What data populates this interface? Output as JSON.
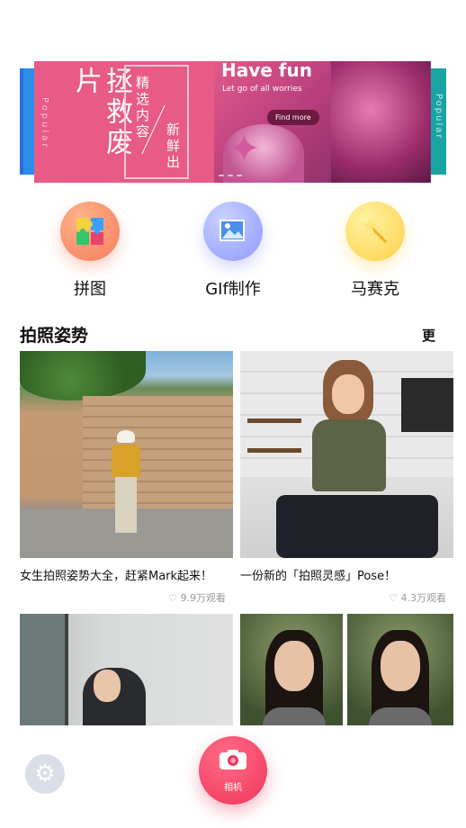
{
  "banner": {
    "side_text": "Popular",
    "vertical_small": "Popular",
    "big_title": "拯救废片",
    "frame_line1": "精选内容",
    "frame_line2": "新鲜出",
    "headline": "Have fun",
    "subline": "Let go of all worries",
    "cta": "Find more"
  },
  "features": [
    {
      "label": "拼图",
      "icon": "puzzle-icon",
      "color": "#f57b5d"
    },
    {
      "label": "GIf制作",
      "icon": "gif-image-icon",
      "color": "#8f98ff"
    },
    {
      "label": "马赛克",
      "icon": "sparkle-wand-icon",
      "color": "#ffd14a"
    }
  ],
  "section": {
    "title": "拍照姿势",
    "more": "更"
  },
  "cards": [
    {
      "caption": "女生拍照姿势大全，赶紧Mark起来！",
      "views": "9.9万观看"
    },
    {
      "caption": "一份新的「拍照灵感」Pose！",
      "views": "4.3万观看"
    },
    {
      "caption": "",
      "views": ""
    },
    {
      "caption": "",
      "views": ""
    }
  ],
  "bottom": {
    "camera_label": "相机",
    "accent": "#f0365a"
  }
}
